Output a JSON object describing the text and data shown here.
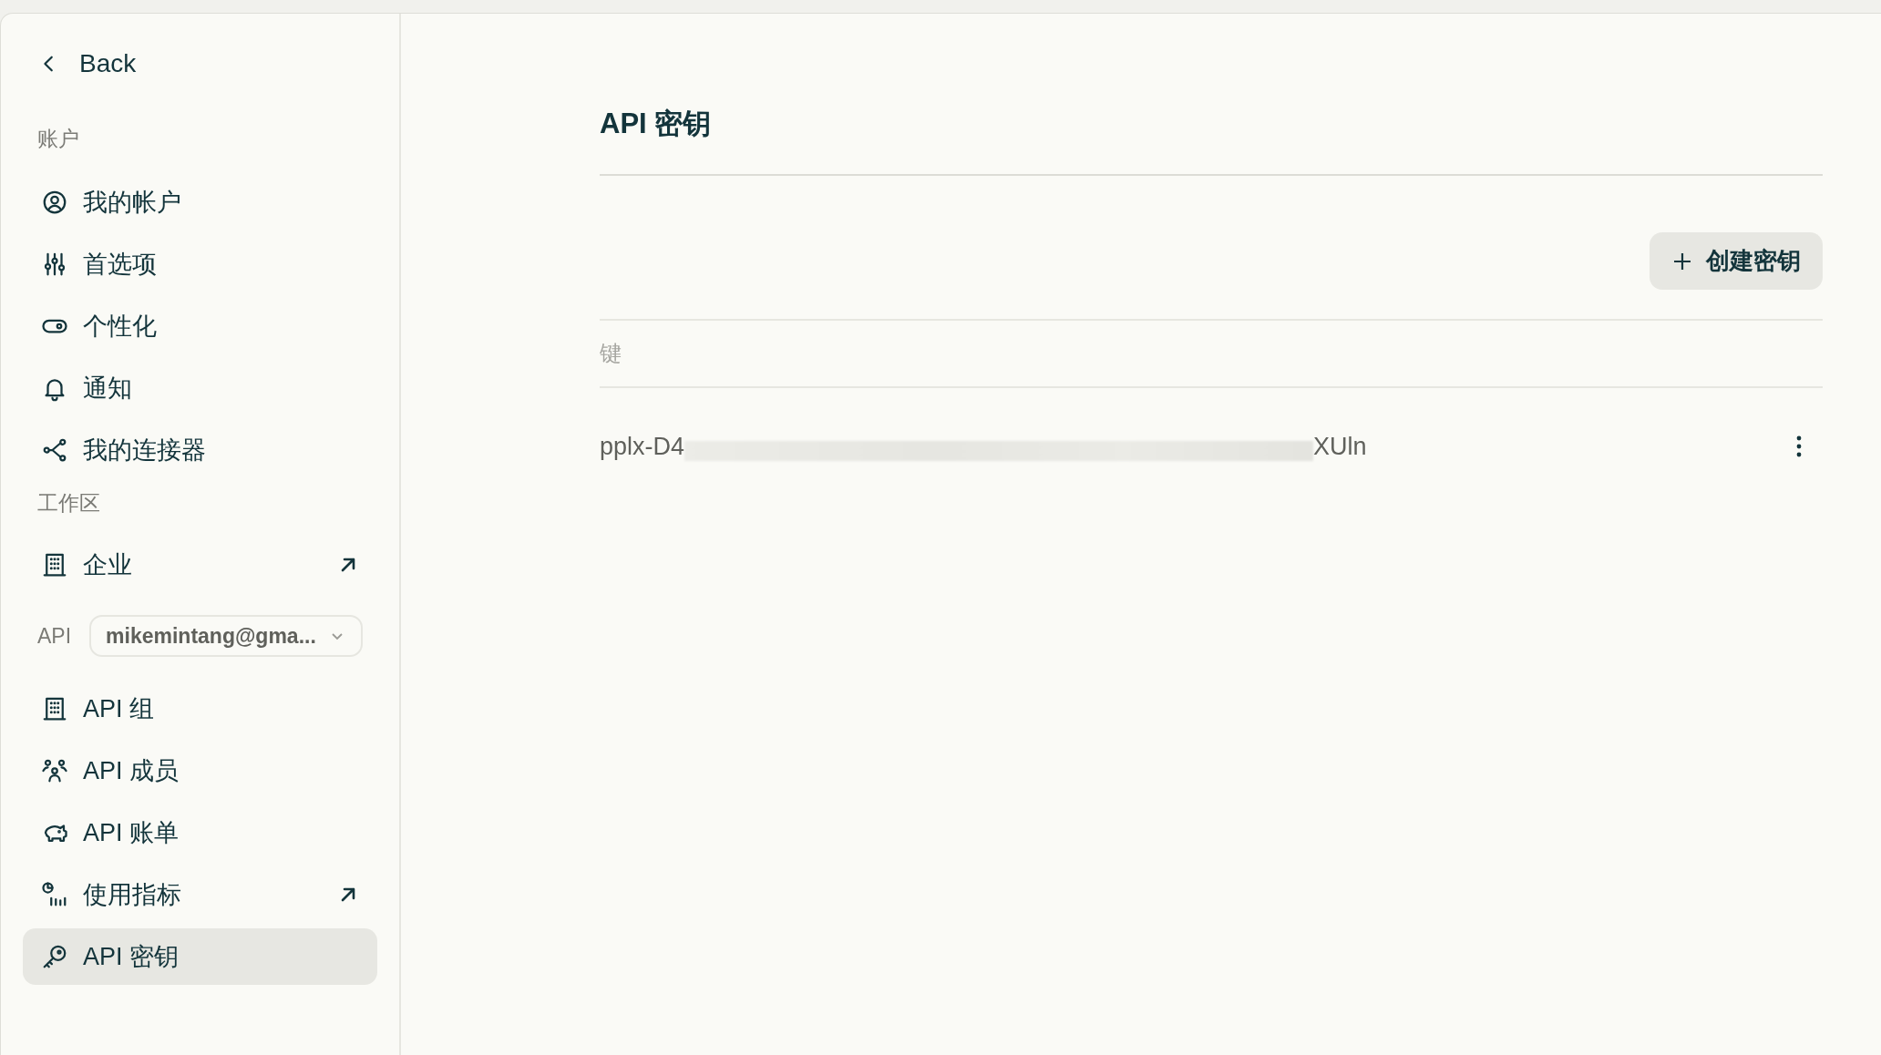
{
  "sidebar": {
    "back": "Back",
    "entries": [
      {
        "kind": "heading",
        "label": "账户"
      },
      {
        "kind": "item",
        "label": "我的帐户",
        "external": false,
        "selected": false
      },
      {
        "kind": "item",
        "label": "首选项",
        "external": false,
        "selected": false
      },
      {
        "kind": "item",
        "label": "个性化",
        "external": false,
        "selected": false
      },
      {
        "kind": "item",
        "label": "通知",
        "external": false,
        "selected": false
      },
      {
        "kind": "item",
        "label": "我的连接器",
        "external": false,
        "selected": false
      },
      {
        "kind": "heading",
        "label": "工作区"
      },
      {
        "kind": "item",
        "label": "企业",
        "external": true,
        "selected": false
      },
      {
        "kind": "selector",
        "label": "API",
        "value": "mikemintang@gma..."
      },
      {
        "kind": "item",
        "label": "API 组",
        "external": false,
        "selected": false
      },
      {
        "kind": "item",
        "label": "API 成员",
        "external": false,
        "selected": false
      },
      {
        "kind": "item",
        "label": "API 账单",
        "external": false,
        "selected": false
      },
      {
        "kind": "item",
        "label": "使用指标",
        "external": true,
        "selected": false
      },
      {
        "kind": "item",
        "label": "API 密钥",
        "external": false,
        "selected": true
      }
    ]
  },
  "main": {
    "title": "API 密钥",
    "create_button": "创建密钥",
    "table": {
      "columns": [
        "键"
      ],
      "rows": [
        {
          "key_start": "pplx-D4",
          "key_end": "XUln"
        }
      ]
    }
  }
}
